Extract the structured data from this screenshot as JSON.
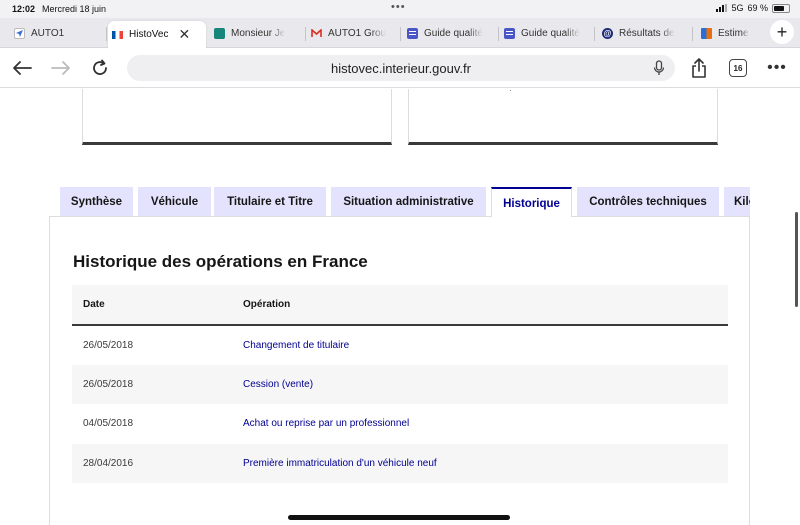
{
  "status_bar": {
    "time": "12:02",
    "date": "Mercredi 18 juin",
    "network": "5G",
    "battery": "69 %"
  },
  "browser": {
    "tabs": [
      {
        "label": "AUTO1",
        "favicon": "auto1-logo-icon",
        "color": "#3c6fd8"
      },
      {
        "label": "HistoVec",
        "favicon": "french-flag-icon",
        "active": true
      },
      {
        "label": "Monsieur Je",
        "favicon": "leaf-logo-icon",
        "color": "#16857a"
      },
      {
        "label": "AUTO1 Grou",
        "favicon": "gmail-icon",
        "color": "#d93025"
      },
      {
        "label": "Guide qualité",
        "favicon": "forms-icon",
        "color": "#4a56c8"
      },
      {
        "label": "Guide qualité",
        "favicon": "forms-icon",
        "color": "#4a56c8"
      },
      {
        "label": "Résultats de",
        "favicon": "at-sign-icon",
        "color": "#1e2a78"
      },
      {
        "label": "Estime",
        "favicon": "color-blocks-icon",
        "color": "#e6700f"
      }
    ],
    "url": "histovec.interieur.gouv.fr",
    "tab_count": "16"
  },
  "content_tabs": [
    {
      "label": "Synthèse"
    },
    {
      "label": "Véhicule"
    },
    {
      "label": "Titulaire et Titre"
    },
    {
      "label": "Situation administrative"
    },
    {
      "label": "Historique",
      "active": true
    },
    {
      "label": "Contrôles techniques"
    },
    {
      "label": "Kilo"
    }
  ],
  "history": {
    "title": "Historique des opérations en France",
    "columns": [
      "Date",
      "Opération"
    ],
    "rows": [
      {
        "date": "26/05/2018",
        "operation": "Changement de titulaire"
      },
      {
        "date": "26/05/2018",
        "operation": "Cession (vente)"
      },
      {
        "date": "04/05/2018",
        "operation": "Achat ou reprise par un professionnel"
      },
      {
        "date": "28/04/2016",
        "operation": "Première immatriculation d'un véhicule neuf"
      }
    ]
  },
  "colors": {
    "accent": "#000091",
    "tab_bg": "#e3e3fd",
    "row_alt": "#f6f6f6"
  }
}
